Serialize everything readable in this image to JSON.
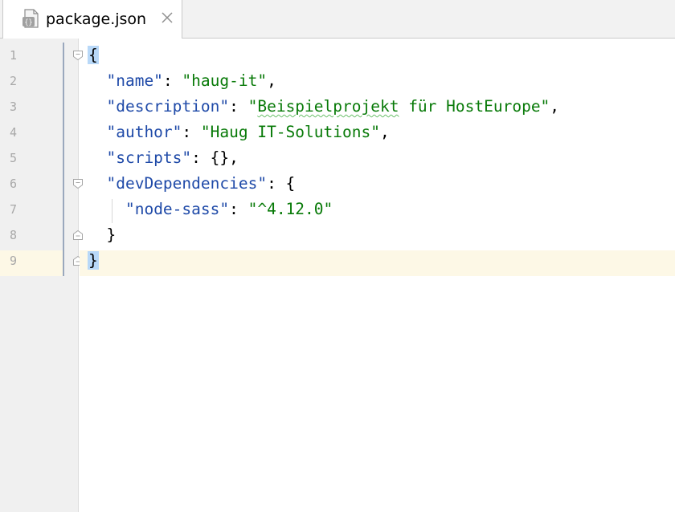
{
  "tab": {
    "title": "package.json",
    "file_icon": "json-file-icon",
    "close_glyph": "×"
  },
  "editor": {
    "caret_line": 9,
    "line_numbers": [
      "1",
      "2",
      "3",
      "4",
      "5",
      "6",
      "7",
      "8",
      "9"
    ],
    "lines": [
      {
        "tokens": [
          {
            "text": "{",
            "role": "brace"
          }
        ]
      },
      {
        "tokens": [
          {
            "text": "  "
          },
          {
            "text": "\"name\"",
            "role": "key"
          },
          {
            "text": ": "
          },
          {
            "text": "\"haug-it\"",
            "role": "str"
          },
          {
            "text": ","
          }
        ]
      },
      {
        "tokens": [
          {
            "text": "  "
          },
          {
            "text": "\"description\"",
            "role": "key"
          },
          {
            "text": ": "
          },
          {
            "text": "\"",
            "role": "str"
          },
          {
            "text": "Beispielprojekt",
            "role": "str-typo"
          },
          {
            "text": " für HostEurope\"",
            "role": "str"
          },
          {
            "text": ","
          }
        ]
      },
      {
        "tokens": [
          {
            "text": "  "
          },
          {
            "text": "\"author\"",
            "role": "key"
          },
          {
            "text": ": "
          },
          {
            "text": "\"Haug IT-Solutions\"",
            "role": "str"
          },
          {
            "text": ","
          }
        ]
      },
      {
        "tokens": [
          {
            "text": "  "
          },
          {
            "text": "\"scripts\"",
            "role": "key"
          },
          {
            "text": ": {},"
          }
        ]
      },
      {
        "tokens": [
          {
            "text": "  "
          },
          {
            "text": "\"devDependencies\"",
            "role": "key"
          },
          {
            "text": ": {"
          }
        ]
      },
      {
        "tokens": [
          {
            "text": "    "
          },
          {
            "text": "\"node-sass\"",
            "role": "key"
          },
          {
            "text": ": "
          },
          {
            "text": "\"^4.12.0\"",
            "role": "str"
          }
        ]
      },
      {
        "tokens": [
          {
            "text": "  }"
          }
        ]
      },
      {
        "tokens": [
          {
            "text": "}",
            "role": "brace"
          }
        ]
      }
    ]
  },
  "colors": {
    "key": "#1f4aa8",
    "string": "#087a08",
    "brace_match_bg": "#b8d8f8",
    "caret_line_bg": "#fdf8e6",
    "gutter_bg": "#f0f0f0"
  }
}
